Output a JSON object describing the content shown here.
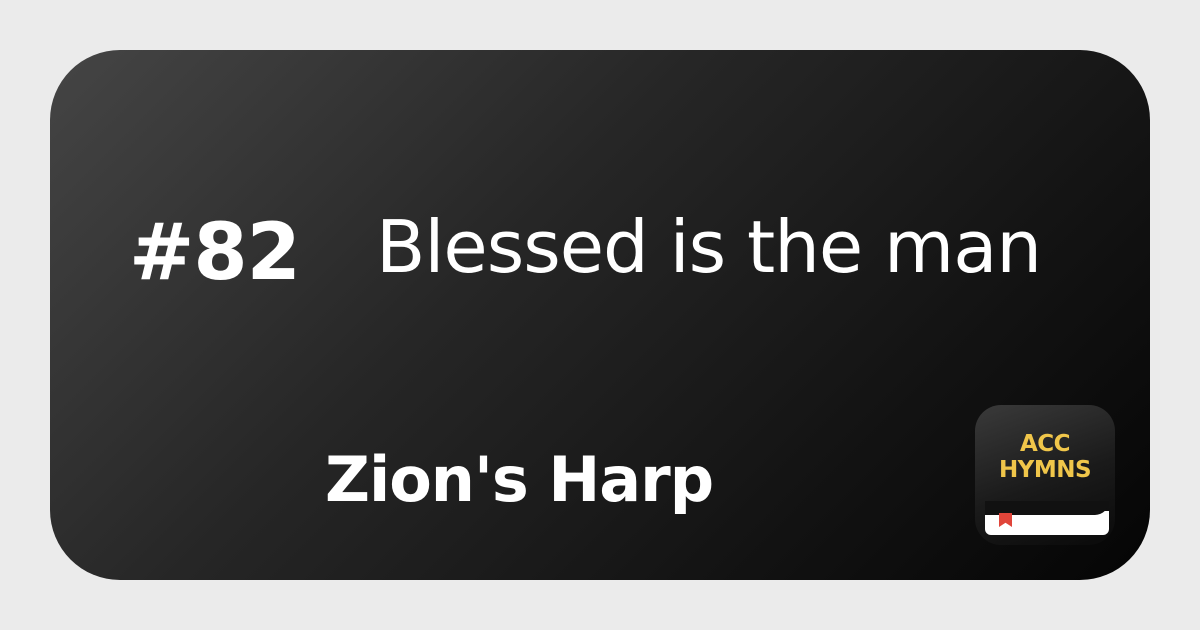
{
  "card": {
    "hymn_number": "#82",
    "hymn_title": "Blessed is the man",
    "hymnal_name": "Zion's Harp"
  },
  "app_icon": {
    "line1": "ACC",
    "line2": "HYMNS",
    "icon_name": "acc-hymns-app-icon",
    "accent_color": "#f0c64a",
    "ribbon_color": "#e0453a"
  },
  "colors": {
    "background": "#ebebeb",
    "card_dark": "#121212",
    "text": "#ffffff"
  }
}
